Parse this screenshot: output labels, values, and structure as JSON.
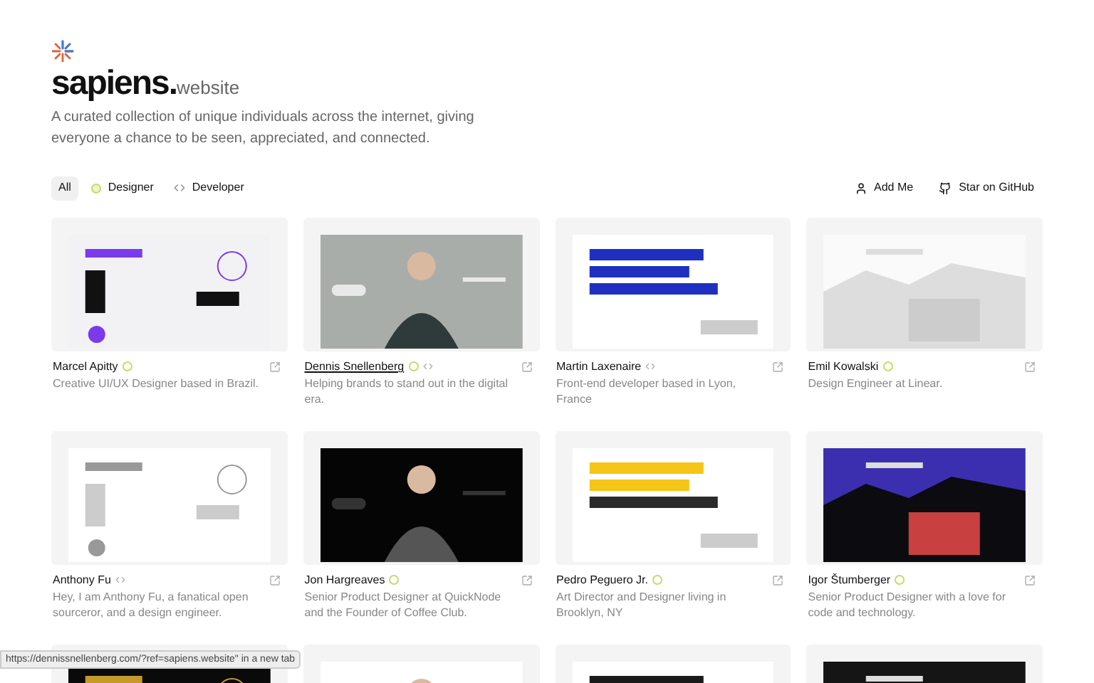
{
  "brand": {
    "name": "sapiens.",
    "suffix": "website"
  },
  "tagline": "A curated collection of unique individuals across the internet, giving everyone a chance to be seen, appreciated, and connected.",
  "filters": [
    {
      "label": "All",
      "kind": "all",
      "selected": true
    },
    {
      "label": "Designer",
      "kind": "designer",
      "selected": false
    },
    {
      "label": "Developer",
      "kind": "developer",
      "selected": false
    }
  ],
  "actions": [
    {
      "label": "Add Me",
      "kind": "user"
    },
    {
      "label": "Star on GitHub",
      "kind": "github"
    }
  ],
  "cards": [
    {
      "name": "Marcel Apitty",
      "roles": [
        {
          "kind": "designer"
        }
      ],
      "description": "Creative UI/UX Designer based in Brazil.",
      "hovered": false
    },
    {
      "name": "Dennis Snellenberg",
      "roles": [
        {
          "kind": "designer"
        },
        {
          "kind": "developer"
        }
      ],
      "description": "Helping brands to stand out in the digital era.",
      "hovered": true
    },
    {
      "name": "Martin Laxenaire",
      "roles": [
        {
          "kind": "developer"
        }
      ],
      "description": "Front-end developer based in Lyon, France",
      "hovered": false
    },
    {
      "name": "Emil Kowalski",
      "roles": [
        {
          "kind": "designer"
        }
      ],
      "description": "Design Engineer at Linear.",
      "hovered": false
    },
    {
      "name": "Anthony Fu",
      "roles": [
        {
          "kind": "developer"
        }
      ],
      "description": "Hey, I am Anthony Fu, a fanatical open sourceror, and a design engineer.",
      "hovered": false
    },
    {
      "name": "Jon Hargreaves",
      "roles": [
        {
          "kind": "designer"
        }
      ],
      "description": "Senior Product Designer at QuickNode and the Founder of Coffee Club.",
      "hovered": false
    },
    {
      "name": "Pedro Peguero Jr.",
      "roles": [
        {
          "kind": "designer"
        }
      ],
      "description": "Art Director and Designer living in Brooklyn, NY",
      "hovered": false
    },
    {
      "name": "Igor Štumberger",
      "roles": [
        {
          "kind": "designer"
        }
      ],
      "description": "Senior Product Designer with a love for code and technology.",
      "hovered": false
    },
    {
      "kind": "picture"
    },
    {
      "kind": "picture"
    },
    {
      "kind": "picture"
    },
    {
      "kind": "picture"
    }
  ],
  "status_bar": "https://dennissnellenberg.com/?ref=sapiens.website\" in a new tab"
}
